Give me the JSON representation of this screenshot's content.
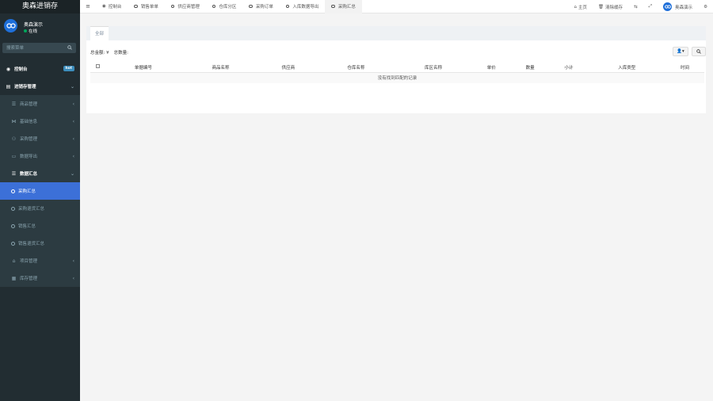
{
  "app": {
    "title": "奥森进销存"
  },
  "user": {
    "name": "奥森演示",
    "status": "在线"
  },
  "search": {
    "placeholder": "搜索菜单"
  },
  "sidebar": {
    "items": [
      {
        "label": "控制台",
        "icon": "dashboard-icon",
        "badge": "hot"
      },
      {
        "label": "进销存管理",
        "icon": "file-icon"
      },
      {
        "label": "商品管理",
        "icon": "list-icon"
      },
      {
        "label": "基础信息",
        "icon": "share-icon"
      },
      {
        "label": "采购管理",
        "icon": "group-icon"
      },
      {
        "label": "数据导出",
        "icon": "folder-icon"
      },
      {
        "label": "数据汇总",
        "icon": "list-icon"
      },
      {
        "label": "采购汇总"
      },
      {
        "label": "采购退货汇总"
      },
      {
        "label": "销售汇总"
      },
      {
        "label": "销售退货汇总"
      },
      {
        "label": "项目管理",
        "icon": "bank-icon"
      },
      {
        "label": "库存管理",
        "icon": "table-icon"
      }
    ]
  },
  "tabs": [
    {
      "label": "控制台"
    },
    {
      "label": "销售单单"
    },
    {
      "label": "供应商管理"
    },
    {
      "label": "仓库分区"
    },
    {
      "label": "采购订单"
    },
    {
      "label": "入库数据导出"
    },
    {
      "label": "采购汇总"
    }
  ],
  "topbar": {
    "home": "主页",
    "clear_cache": "清除缓存",
    "username": "奥森演示"
  },
  "panel": {
    "tab": "全部",
    "total_amount_label": "总金额:",
    "total_amount_value": "¥",
    "total_qty_label": "总数量:"
  },
  "table": {
    "columns": [
      "单据编号",
      "商品名称",
      "供应商",
      "仓库名称",
      "库区名称",
      "单价",
      "数量",
      "小计",
      "入库类型",
      "时间"
    ],
    "empty_text": "没有找到匹配的记录"
  },
  "colors": {
    "sidebar_bg": "#222d32",
    "accent": "#3c70d8",
    "badge": "#3c8dbc",
    "online": "#00a65a"
  }
}
